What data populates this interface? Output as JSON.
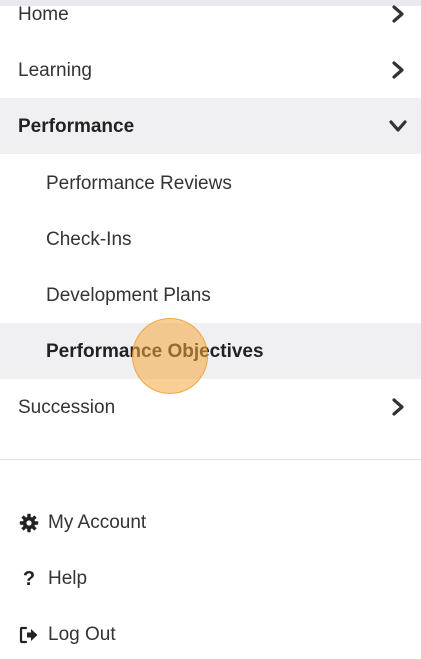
{
  "nav": {
    "items": [
      {
        "label": "Home",
        "expanded": false
      },
      {
        "label": "Learning",
        "expanded": false
      },
      {
        "label": "Performance",
        "expanded": true,
        "children": [
          {
            "label": "Performance Reviews"
          },
          {
            "label": "Check-Ins"
          },
          {
            "label": "Development Plans"
          },
          {
            "label": "Performance Objectives",
            "active": true
          }
        ]
      },
      {
        "label": "Succession",
        "expanded": false
      }
    ]
  },
  "utility": {
    "account_label": "My Account",
    "help_label": "Help",
    "logout_label": "Log Out"
  },
  "colors": {
    "active_bg": "#f0f0f2",
    "text": "#333333",
    "cursor_highlight": "#f5a83c"
  }
}
